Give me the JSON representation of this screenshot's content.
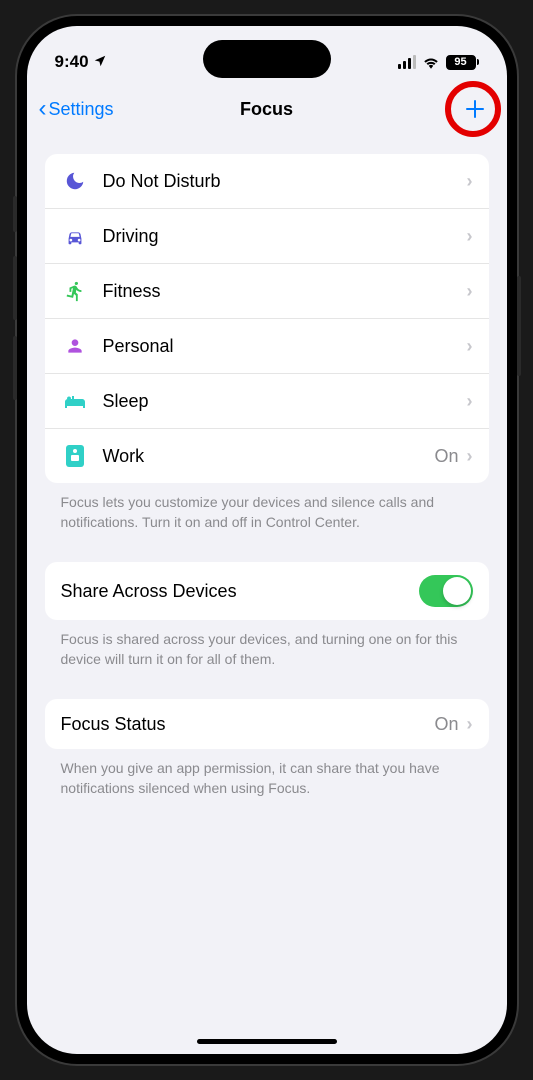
{
  "status": {
    "time": "9:40",
    "battery": "95"
  },
  "nav": {
    "back": "Settings",
    "title": "Focus"
  },
  "focus_modes": [
    {
      "label": "Do Not Disturb",
      "icon": "moon",
      "color": "#5856d6",
      "value": ""
    },
    {
      "label": "Driving",
      "icon": "car",
      "color": "#5856d6",
      "value": ""
    },
    {
      "label": "Fitness",
      "icon": "running",
      "color": "#34c759",
      "value": ""
    },
    {
      "label": "Personal",
      "icon": "person",
      "color": "#af52de",
      "value": ""
    },
    {
      "label": "Sleep",
      "icon": "bed",
      "color": "#30d0c7",
      "value": ""
    },
    {
      "label": "Work",
      "icon": "badge",
      "color": "#30d0c7",
      "value": "On"
    }
  ],
  "footer1": "Focus lets you customize your devices and silence calls and notifications. Turn it on and off in Control Center.",
  "share": {
    "label": "Share Across Devices",
    "enabled": true
  },
  "footer2": "Focus is shared across your devices, and turning one on for this device will turn it on for all of them.",
  "focus_status": {
    "label": "Focus Status",
    "value": "On"
  },
  "footer3": "When you give an app permission, it can share that you have notifications silenced when using Focus."
}
